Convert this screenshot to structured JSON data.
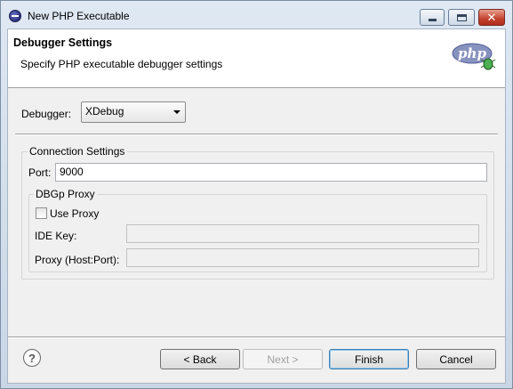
{
  "window": {
    "title": "New PHP Executable",
    "close_glyph": "✕"
  },
  "banner": {
    "heading": "Debugger Settings",
    "subheading": "Specify PHP executable debugger settings",
    "logo_text": "php"
  },
  "debugger": {
    "label": "Debugger:",
    "selected": "XDebug"
  },
  "connection": {
    "legend": "Connection Settings",
    "port_label": "Port:",
    "port_value": "9000"
  },
  "proxy": {
    "legend": "DBGp Proxy",
    "use_proxy_label": "Use Proxy",
    "use_proxy_checked": false,
    "ide_key_label": "IDE Key:",
    "ide_key_value": "",
    "host_port_label": "Proxy (Host:Port):",
    "host_port_value": ""
  },
  "footer": {
    "help_glyph": "?",
    "back_label": "< Back",
    "next_label": "Next >",
    "finish_label": "Finish",
    "cancel_label": "Cancel"
  },
  "colors": {
    "titlebar": "#dfe8f3",
    "close_button": "#c3412e",
    "php_logo": "#8892bf",
    "default_button_border": "#3c7fb1"
  }
}
